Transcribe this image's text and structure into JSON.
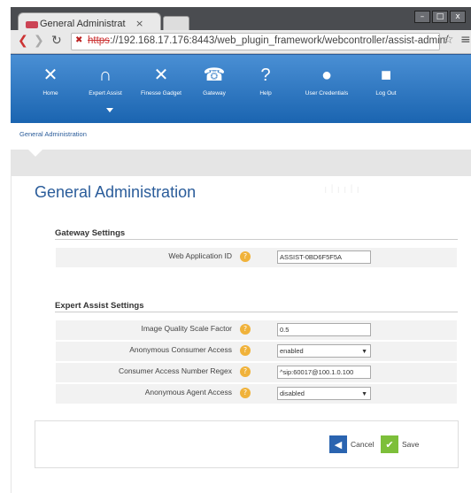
{
  "browser": {
    "tab_title": "General Administrat",
    "tab_close": "×",
    "url_scheme": "https",
    "url_rest": "://192.168.17.176:8443/web_plugin_framework/webcontroller/assist-admin/",
    "window_buttons": [
      "–",
      "□",
      "x"
    ]
  },
  "nav": {
    "items": [
      {
        "label": "Home",
        "icon": "network-icon",
        "glyph": "✕"
      },
      {
        "label": "Expert Assist",
        "icon": "headset-icon",
        "glyph": "∩"
      },
      {
        "label": "Finesse Gadget",
        "icon": "network-icon",
        "glyph": "✕"
      },
      {
        "label": "Gateway",
        "icon": "phone-icon",
        "glyph": "☎"
      },
      {
        "label": "Help",
        "icon": "help-icon",
        "glyph": "?"
      },
      {
        "label": "User Credentials",
        "icon": "user-icon",
        "glyph": "●"
      },
      {
        "label": "Log Out",
        "icon": "lock-icon",
        "glyph": "■"
      }
    ]
  },
  "breadcrumb": "General Administration",
  "page_title": "General Administration",
  "sections": {
    "gateway": {
      "title": "Gateway Settings",
      "web_app_id_label": "Web Application ID",
      "web_app_id_value": "ASSIST-0BD6F5F5A"
    },
    "expert": {
      "title": "Expert Assist Settings",
      "image_quality_label": "Image Quality Scale Factor",
      "image_quality_value": "0.5",
      "anon_consumer_label": "Anonymous Consumer Access",
      "anon_consumer_value": "enabled",
      "consumer_regex_label": "Consumer Access Number Regex",
      "consumer_regex_value": "^sip:60017@100.1.0.100",
      "anon_agent_label": "Anonymous Agent Access",
      "anon_agent_value": "disabled"
    }
  },
  "footer": {
    "cancel_label": "Cancel",
    "save_label": "Save"
  },
  "colors": {
    "brand_blue": "#1a64b0",
    "title_blue": "#2a5c9a",
    "help_orange": "#f0b23a",
    "save_green": "#7dbf3a"
  }
}
